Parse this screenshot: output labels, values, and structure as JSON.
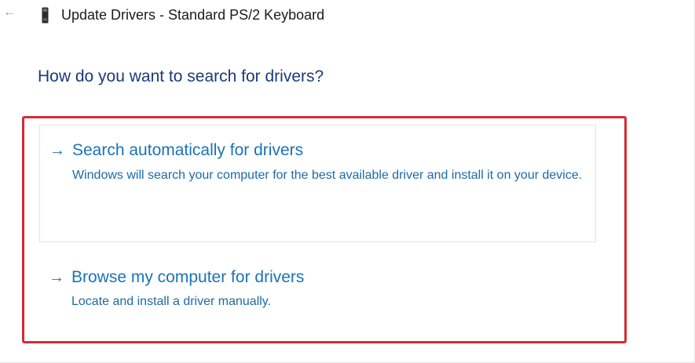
{
  "window": {
    "title": "Update Drivers - Standard PS/2 Keyboard",
    "back_icon": "back-arrow-icon",
    "device_icon": "keyboard-device-icon"
  },
  "main": {
    "heading": "How do you want to search for drivers?",
    "options": [
      {
        "arrow": "→",
        "title": "Search automatically for drivers",
        "description": "Windows will search your computer for the best available driver and install it on your device."
      },
      {
        "arrow": "→",
        "title": "Browse my computer for drivers",
        "description": "Locate and install a driver manually."
      }
    ]
  },
  "colors": {
    "heading": "#1a3a7a",
    "link": "#1a73b8",
    "highlight_frame": "#d62b35"
  }
}
